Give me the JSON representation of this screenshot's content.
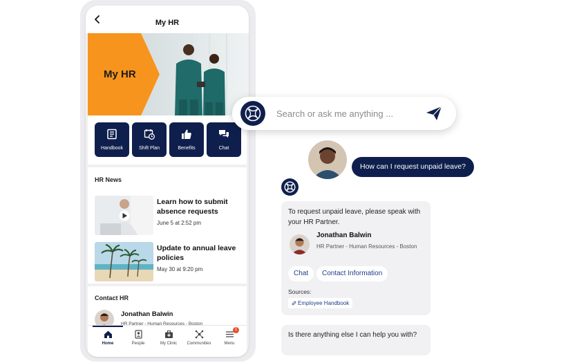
{
  "header": {
    "title": "My HR"
  },
  "banner": {
    "label": "My HR"
  },
  "actions": [
    {
      "label": "Handbook",
      "icon": "book-icon"
    },
    {
      "label": "Shift Plan",
      "icon": "calendar-clock-icon"
    },
    {
      "label": "Benefits",
      "icon": "thumbs-up-icon"
    },
    {
      "label": "Chat",
      "icon": "chat-bubbles-icon"
    }
  ],
  "news": {
    "title": "HR News",
    "items": [
      {
        "headline": "Learn how to submit absence requests",
        "date": "June 5 at 2:52 pm",
        "thumb": "video-thumbnail"
      },
      {
        "headline": "Update to annual leave policies",
        "date": "May 30 at 9:20 pm",
        "thumb": "beach-thumbnail"
      }
    ]
  },
  "contact": {
    "title": "Contact HR",
    "name": "Jonathan Balwin",
    "role": "HR Partner - Human Resources - Boston"
  },
  "tabbar": [
    {
      "label": "Home",
      "icon": "home-icon",
      "active": true
    },
    {
      "label": "People",
      "icon": "people-icon"
    },
    {
      "label": "My Clinic",
      "icon": "clinic-bag-icon"
    },
    {
      "label": "Communities",
      "icon": "network-icon"
    },
    {
      "label": "Menu",
      "icon": "menu-icon",
      "badge": "1"
    }
  ],
  "search": {
    "placeholder": "Search or ask me anything ..."
  },
  "chat": {
    "user_message": "How can I request unpaid leave?",
    "bot_message": "To request unpaid leave, please speak with your HR Partner.",
    "contact_name": "Jonathan Balwin",
    "contact_role": "HR Partner - Human Resources - Boston",
    "chips": [
      "Chat",
      "Contact Information"
    ],
    "sources_label": "Sources:",
    "source": "Employee Handbook",
    "followup": "Is there anything else I can help you with?"
  },
  "colors": {
    "navy": "#0f1f4d",
    "orange": "#f7941d",
    "badge": "#e8512c",
    "link": "#1e3d8a"
  }
}
